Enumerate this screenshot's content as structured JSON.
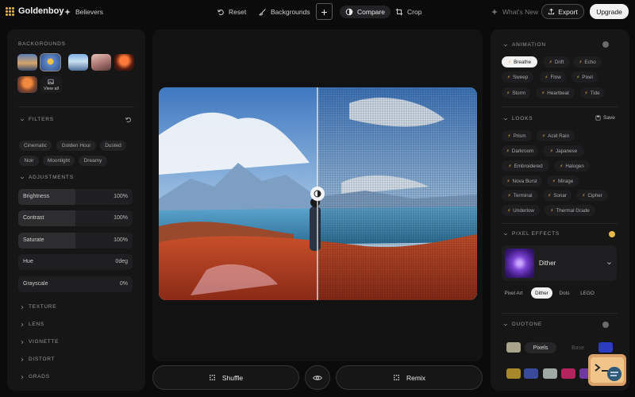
{
  "app": {
    "name": "Goldenboy",
    "nav_link": "Believers"
  },
  "toolbar": {
    "reset": "Reset",
    "backgrounds": "Backgrounds",
    "add": "+",
    "compare": "Compare",
    "crop": "Crop",
    "whats_new": "What's New",
    "export": "Export",
    "upgrade": "Upgrade"
  },
  "left_panel": {
    "backgrounds_title": "BACKGROUNDS",
    "view_all": "View all",
    "filters_title": "FILTERS",
    "filter_chips": [
      "Cinematic",
      "Golden Hour",
      "Dusted",
      "Noir",
      "Moonlight",
      "Dreamy"
    ],
    "adjustments_title": "ADJUSTMENTS",
    "sliders": [
      {
        "label": "Brightness",
        "value": "100%",
        "fill": 0.5
      },
      {
        "label": "Contrast",
        "value": "100%",
        "fill": 0.5
      },
      {
        "label": "Saturate",
        "value": "100%",
        "fill": 0.5
      },
      {
        "label": "Hue",
        "value": "0deg",
        "fill": 0
      },
      {
        "label": "Grayscale",
        "value": "0%",
        "fill": 0
      }
    ],
    "collapsed_sections": [
      "TEXTURE",
      "LENS",
      "VIGNETTE",
      "DISTORT",
      "GRADS"
    ]
  },
  "canvas": {
    "shuffle": "Shuffle",
    "remix": "Remix"
  },
  "right_panel": {
    "animation_title": "ANIMATION",
    "animation_chips": [
      "Breathe",
      "Drift",
      "Echo",
      "Sweep",
      "Flow",
      "Pixel",
      "Storm",
      "Heartbeat",
      "Tide"
    ],
    "animation_selected": "Breathe",
    "looks_title": "LOOKS",
    "looks_save": "Save",
    "looks_chips": [
      "Prism",
      "Acid Rain",
      "Darkroom",
      "Japanese",
      "Embroidered",
      "Halogen",
      "Nova Burst",
      "Mirage",
      "Terminal",
      "Sonar",
      "Cipher",
      "Underlow",
      "Thermal Grade"
    ],
    "pixel_effects_title": "PIXEL EFFECTS",
    "pixel_effect_selected": "Dither",
    "pixel_chips": [
      "Pixel Art",
      "Dither",
      "Dots",
      "LEGO"
    ],
    "pixel_chip_selected": "Dither",
    "duotone_title": "DUOTONE",
    "duotone_modes": [
      "Pixels",
      "Base"
    ],
    "colors": {
      "accent": "#e7b84b",
      "duotone_light": "#a8a48c",
      "duotone_dark": "#2c3cc0"
    },
    "duotone_swatches": [
      "#a8862a",
      "#3a4a9a",
      "#a0a8a4",
      "#b3245e",
      "#6f3aa0"
    ]
  }
}
